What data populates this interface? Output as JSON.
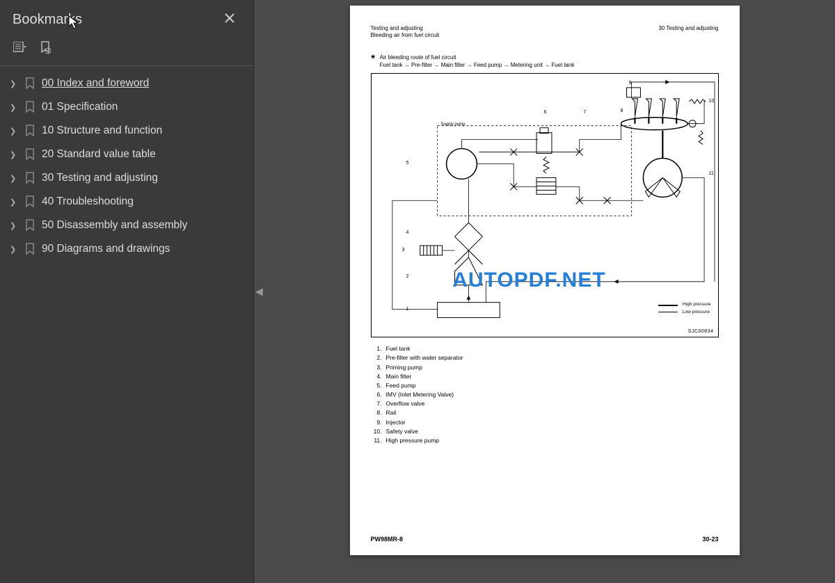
{
  "sidebar": {
    "title": "Bookmarks",
    "items": [
      {
        "label": "00 Index and foreword",
        "active": true
      },
      {
        "label": "01 Specification"
      },
      {
        "label": "10 Structure and function"
      },
      {
        "label": "20 Standard value table"
      },
      {
        "label": "30 Testing and adjusting"
      },
      {
        "label": "40 Troubleshooting"
      },
      {
        "label": "50 Disassembly and assembly"
      },
      {
        "label": "90 Diagrams and drawings"
      }
    ]
  },
  "page": {
    "headerLeftLine1": "Testing and adjusting",
    "headerLeftLine2": "Bleeding air from fuel circuit",
    "headerRight": "30 Testing and adjusting",
    "bulletTitle": "Air bleeding route of fuel circuit",
    "bulletRoute": "Fuel tank → Pre-filter → Main filter → Feed pump → Metering unit → Fuel tank",
    "diagramId": "SJC00834",
    "legendHigh": ":High pressure",
    "legendLow": ":Low pressure",
    "supplyPump": "Supply pump",
    "parts": [
      {
        "num": "1.",
        "name": "Fuel tank"
      },
      {
        "num": "2.",
        "name": "Pre-filter with water separator"
      },
      {
        "num": "3.",
        "name": "Priming pump"
      },
      {
        "num": "4.",
        "name": "Main filter"
      },
      {
        "num": "5.",
        "name": "Feed pump"
      },
      {
        "num": "6.",
        "name": "IMV (Inlet Metering Valve)"
      },
      {
        "num": "7.",
        "name": "Overflow valve"
      },
      {
        "num": "8.",
        "name": "Rail"
      },
      {
        "num": "9.",
        "name": "Injector"
      },
      {
        "num": "10.",
        "name": "Safety valve"
      },
      {
        "num": "11.",
        "name": "High pressure pump"
      }
    ],
    "footerLeft": "PW98MR-8",
    "footerRight": "30-23",
    "watermark": "AUTOPDF.NET"
  },
  "callouts": {
    "c1": "1",
    "c2": "2",
    "c3": "3",
    "c4": "4",
    "c5": "5",
    "c6": "6",
    "c7": "7",
    "c8": "8",
    "c9": "9",
    "c10": "10",
    "c11": "11"
  }
}
